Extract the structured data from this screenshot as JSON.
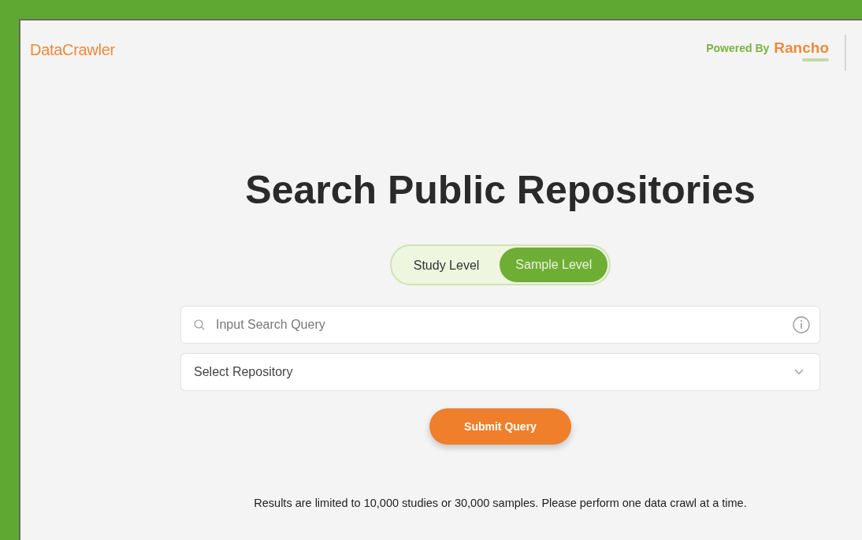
{
  "header": {
    "logo": "DataCrawler",
    "powered_by": "Powered By",
    "brand": "Rancho"
  },
  "title": "Search Public Repositories",
  "level_toggle": [
    {
      "label": "Study Level",
      "selected": false
    },
    {
      "label": "Sample Level",
      "selected": true
    }
  ],
  "search": {
    "placeholder": "Input Search Query"
  },
  "repository_select": {
    "placeholder": "Select Repository"
  },
  "submit_button": "Submit Query",
  "note": "Results are limited to 10,000 studies or 30,000 samples. Please perform one data crawl at a time."
}
